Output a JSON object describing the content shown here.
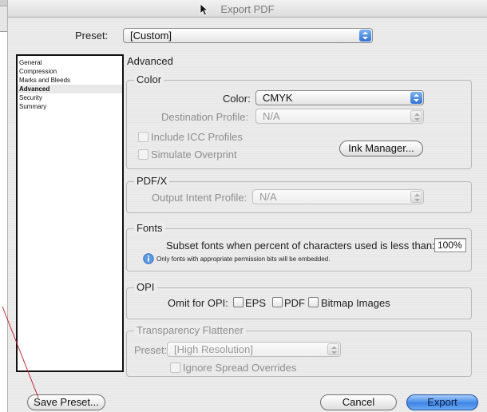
{
  "dialog": {
    "title": "Export PDF",
    "preset_label": "Preset:",
    "preset_value": "[Custom]"
  },
  "sidebar": {
    "items": [
      {
        "label": "General"
      },
      {
        "label": "Compression"
      },
      {
        "label": "Marks and Bleeds"
      },
      {
        "label": "Advanced"
      },
      {
        "label": "Security"
      },
      {
        "label": "Summary"
      }
    ],
    "selected_index": 3
  },
  "panel": {
    "heading": "Advanced",
    "color_group": {
      "title": "Color",
      "color_label": "Color:",
      "color_value": "CMYK",
      "destination_label": "Destination Profile:",
      "destination_value": "N/A",
      "include_icc_label": "Include ICC Profiles",
      "simulate_overprint_label": "Simulate Overprint",
      "ink_manager_label": "Ink Manager..."
    },
    "pdfx_group": {
      "title": "PDF/X",
      "output_intent_label": "Output Intent Profile:",
      "output_intent_value": "N/A"
    },
    "fonts_group": {
      "title": "Fonts",
      "subset_label": "Subset fonts when percent of characters used is less than:",
      "subset_value": "100%",
      "note": "Only fonts with appropriate permission bits will be embedded."
    },
    "opi_group": {
      "title": "OPI",
      "omit_label": "Omit for OPI:",
      "eps_label": "EPS",
      "pdf_label": "PDF",
      "bitmap_label": "Bitmap Images"
    },
    "transparency_group": {
      "title": "Transparency Flattener",
      "preset_label": "Preset:",
      "preset_value": "[High Resolution]",
      "ignore_spread_label": "Ignore Spread Overrides"
    }
  },
  "footer": {
    "save_preset_label": "Save Preset...",
    "cancel_label": "Cancel",
    "export_label": "Export"
  },
  "colors": {
    "accent_blue": "#3f86e6",
    "annotation_line": "#c0262c"
  }
}
